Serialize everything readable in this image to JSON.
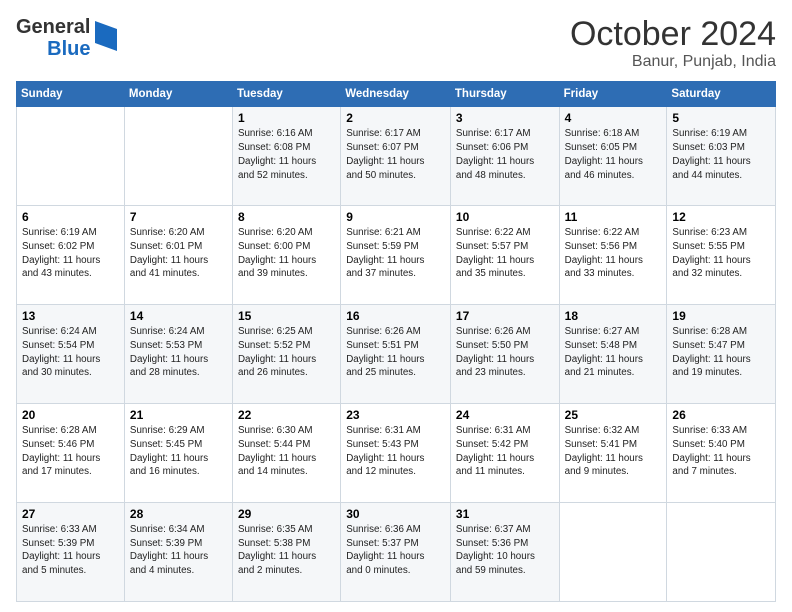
{
  "header": {
    "logo_line1": "General",
    "logo_line2": "Blue",
    "month": "October 2024",
    "location": "Banur, Punjab, India"
  },
  "days_of_week": [
    "Sunday",
    "Monday",
    "Tuesday",
    "Wednesday",
    "Thursday",
    "Friday",
    "Saturday"
  ],
  "weeks": [
    [
      {
        "day": "",
        "info": ""
      },
      {
        "day": "",
        "info": ""
      },
      {
        "day": "1",
        "info": "Sunrise: 6:16 AM\nSunset: 6:08 PM\nDaylight: 11 hours\nand 52 minutes."
      },
      {
        "day": "2",
        "info": "Sunrise: 6:17 AM\nSunset: 6:07 PM\nDaylight: 11 hours\nand 50 minutes."
      },
      {
        "day": "3",
        "info": "Sunrise: 6:17 AM\nSunset: 6:06 PM\nDaylight: 11 hours\nand 48 minutes."
      },
      {
        "day": "4",
        "info": "Sunrise: 6:18 AM\nSunset: 6:05 PM\nDaylight: 11 hours\nand 46 minutes."
      },
      {
        "day": "5",
        "info": "Sunrise: 6:19 AM\nSunset: 6:03 PM\nDaylight: 11 hours\nand 44 minutes."
      }
    ],
    [
      {
        "day": "6",
        "info": "Sunrise: 6:19 AM\nSunset: 6:02 PM\nDaylight: 11 hours\nand 43 minutes."
      },
      {
        "day": "7",
        "info": "Sunrise: 6:20 AM\nSunset: 6:01 PM\nDaylight: 11 hours\nand 41 minutes."
      },
      {
        "day": "8",
        "info": "Sunrise: 6:20 AM\nSunset: 6:00 PM\nDaylight: 11 hours\nand 39 minutes."
      },
      {
        "day": "9",
        "info": "Sunrise: 6:21 AM\nSunset: 5:59 PM\nDaylight: 11 hours\nand 37 minutes."
      },
      {
        "day": "10",
        "info": "Sunrise: 6:22 AM\nSunset: 5:57 PM\nDaylight: 11 hours\nand 35 minutes."
      },
      {
        "day": "11",
        "info": "Sunrise: 6:22 AM\nSunset: 5:56 PM\nDaylight: 11 hours\nand 33 minutes."
      },
      {
        "day": "12",
        "info": "Sunrise: 6:23 AM\nSunset: 5:55 PM\nDaylight: 11 hours\nand 32 minutes."
      }
    ],
    [
      {
        "day": "13",
        "info": "Sunrise: 6:24 AM\nSunset: 5:54 PM\nDaylight: 11 hours\nand 30 minutes."
      },
      {
        "day": "14",
        "info": "Sunrise: 6:24 AM\nSunset: 5:53 PM\nDaylight: 11 hours\nand 28 minutes."
      },
      {
        "day": "15",
        "info": "Sunrise: 6:25 AM\nSunset: 5:52 PM\nDaylight: 11 hours\nand 26 minutes."
      },
      {
        "day": "16",
        "info": "Sunrise: 6:26 AM\nSunset: 5:51 PM\nDaylight: 11 hours\nand 25 minutes."
      },
      {
        "day": "17",
        "info": "Sunrise: 6:26 AM\nSunset: 5:50 PM\nDaylight: 11 hours\nand 23 minutes."
      },
      {
        "day": "18",
        "info": "Sunrise: 6:27 AM\nSunset: 5:48 PM\nDaylight: 11 hours\nand 21 minutes."
      },
      {
        "day": "19",
        "info": "Sunrise: 6:28 AM\nSunset: 5:47 PM\nDaylight: 11 hours\nand 19 minutes."
      }
    ],
    [
      {
        "day": "20",
        "info": "Sunrise: 6:28 AM\nSunset: 5:46 PM\nDaylight: 11 hours\nand 17 minutes."
      },
      {
        "day": "21",
        "info": "Sunrise: 6:29 AM\nSunset: 5:45 PM\nDaylight: 11 hours\nand 16 minutes."
      },
      {
        "day": "22",
        "info": "Sunrise: 6:30 AM\nSunset: 5:44 PM\nDaylight: 11 hours\nand 14 minutes."
      },
      {
        "day": "23",
        "info": "Sunrise: 6:31 AM\nSunset: 5:43 PM\nDaylight: 11 hours\nand 12 minutes."
      },
      {
        "day": "24",
        "info": "Sunrise: 6:31 AM\nSunset: 5:42 PM\nDaylight: 11 hours\nand 11 minutes."
      },
      {
        "day": "25",
        "info": "Sunrise: 6:32 AM\nSunset: 5:41 PM\nDaylight: 11 hours\nand 9 minutes."
      },
      {
        "day": "26",
        "info": "Sunrise: 6:33 AM\nSunset: 5:40 PM\nDaylight: 11 hours\nand 7 minutes."
      }
    ],
    [
      {
        "day": "27",
        "info": "Sunrise: 6:33 AM\nSunset: 5:39 PM\nDaylight: 11 hours\nand 5 minutes."
      },
      {
        "day": "28",
        "info": "Sunrise: 6:34 AM\nSunset: 5:39 PM\nDaylight: 11 hours\nand 4 minutes."
      },
      {
        "day": "29",
        "info": "Sunrise: 6:35 AM\nSunset: 5:38 PM\nDaylight: 11 hours\nand 2 minutes."
      },
      {
        "day": "30",
        "info": "Sunrise: 6:36 AM\nSunset: 5:37 PM\nDaylight: 11 hours\nand 0 minutes."
      },
      {
        "day": "31",
        "info": "Sunrise: 6:37 AM\nSunset: 5:36 PM\nDaylight: 10 hours\nand 59 minutes."
      },
      {
        "day": "",
        "info": ""
      },
      {
        "day": "",
        "info": ""
      }
    ]
  ]
}
